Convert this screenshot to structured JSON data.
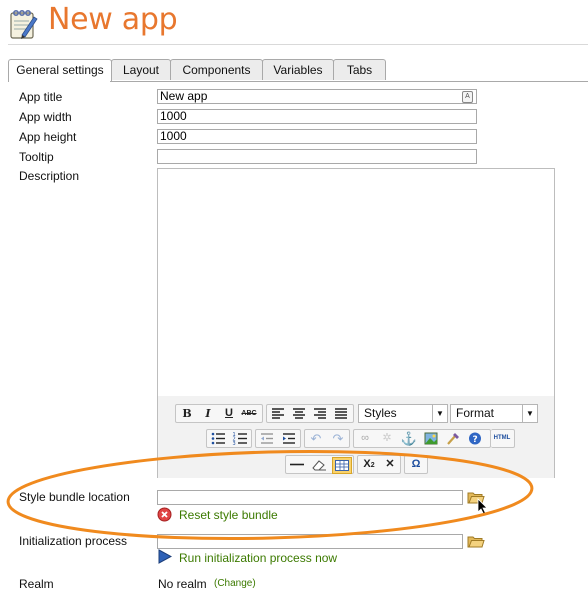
{
  "header": {
    "title": "New app"
  },
  "tabs": [
    {
      "label": "General settings",
      "active": true
    },
    {
      "label": "Layout",
      "active": false
    },
    {
      "label": "Components",
      "active": false
    },
    {
      "label": "Variables",
      "active": false
    },
    {
      "label": "Tabs",
      "active": false
    }
  ],
  "form": {
    "app_title": {
      "label": "App title",
      "value": "New app"
    },
    "app_width": {
      "label": "App width",
      "value": "1000"
    },
    "app_height": {
      "label": "App height",
      "value": "1000"
    },
    "tooltip": {
      "label": "Tooltip",
      "value": ""
    },
    "description": {
      "label": "Description",
      "value": ""
    },
    "style_bundle": {
      "label": "Style bundle location",
      "value": "",
      "reset_label": "Reset style bundle"
    },
    "init_process": {
      "label": "Initialization process",
      "value": "",
      "run_label": "Run initialization process now"
    },
    "realm": {
      "label": "Realm",
      "value": "No realm",
      "change_label": "(Change)"
    }
  },
  "editor_toolbar": {
    "styles_select": "Styles",
    "format_select": "Format",
    "row1": [
      "bold-icon",
      "italic-icon",
      "underline-icon",
      "strikethrough-icon",
      "align-left-icon",
      "align-center-icon",
      "align-right-icon",
      "align-justify-icon"
    ],
    "row2": [
      "bullet-list-icon",
      "numbered-list-icon",
      "outdent-icon",
      "indent-icon",
      "undo-icon",
      "redo-icon",
      "link-icon",
      "unlink-icon",
      "anchor-icon",
      "image-icon",
      "cleanup-icon",
      "help-icon",
      "html-icon"
    ],
    "row3": [
      "horizontal-rule-icon",
      "eraser-icon",
      "table-icon",
      "subscript-icon",
      "remove-format-icon",
      "special-char-icon"
    ],
    "html_button_text": "HTML"
  },
  "colors": {
    "title": "#e8772e",
    "highlight_ellipse": "#f08a1e",
    "link": "#3c7a00"
  }
}
